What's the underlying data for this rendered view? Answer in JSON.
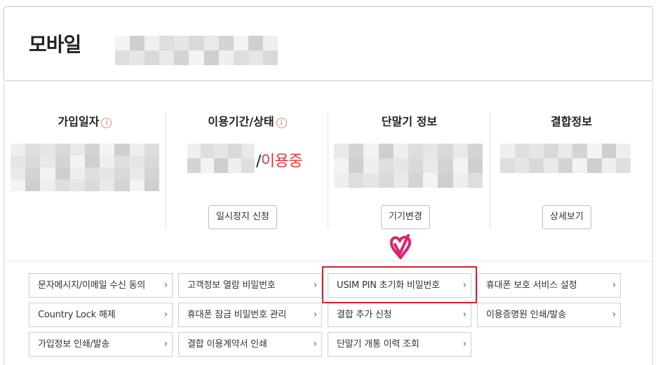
{
  "header": {
    "title": "모바일"
  },
  "info_columns": [
    {
      "title": "가입일자",
      "has_info_icon": true
    },
    {
      "title": "이용기간/상태",
      "has_info_icon": true,
      "status": "이용중",
      "status_separator": "/",
      "button": "일시정지 신청"
    },
    {
      "title": "단말기 정보",
      "has_info_icon": false,
      "button": "기기변경"
    },
    {
      "title": "결합정보",
      "has_info_icon": false,
      "button": "상세보기"
    }
  ],
  "info_icon_glyph": "i",
  "chevron_glyph": "›",
  "menu": {
    "rows": [
      [
        "문자메시지/이메일 수신 동의",
        "고객정보 열람 비밀번호",
        "USIM PIN 초기화 비밀번호",
        "휴대폰 보호 서비스 설정"
      ],
      [
        "Country Lock 해제",
        "휴대폰 잠금 비밀번호 관리",
        "결합 추가 신청",
        "이용증명원 인쇄/발송"
      ],
      [
        "가입정보 인쇄/발송",
        "결합 이용계약서 인쇄",
        "단말기 개통 이력 조회"
      ]
    ],
    "highlighted": "USIM PIN 초기화 비밀번호"
  },
  "colors": {
    "status": "#e0393e",
    "highlight": "#d4202c",
    "heart": "#d8246e",
    "info_icon": "#e06a5a"
  },
  "icons": {
    "pointer": "heart-check-icon",
    "info": "info-icon",
    "chevron": "chevron-right-icon"
  }
}
